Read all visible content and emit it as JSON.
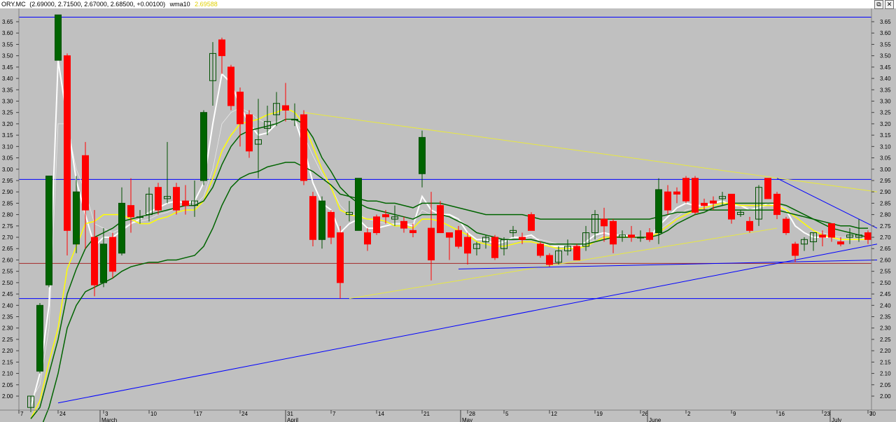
{
  "header": {
    "symbol": "ORY.MC",
    "ohlc_text": "(2.69000, 2.71500, 2.67000, 2.68500, +0.00100)",
    "indicator": "wma10",
    "indicator_value": "2.69588",
    "indicator_color": "#ffff00"
  },
  "window_buttons": {
    "restore": "⧉",
    "close": "✕"
  },
  "colors": {
    "background": "#c0c0c0",
    "up_candle_edge": "#005000",
    "up_candle_fill_strong": "#006400",
    "down_candle": "#ff0000",
    "ma_white": "#ffffff",
    "ma_yellow": "#ffff00",
    "ma_darkgreen": "#006400",
    "ma_thin_white": "#e8e8e8",
    "support_line": "#a52a2a",
    "trend_blue": "#0000ff",
    "trend_yellow": "#e8e840"
  },
  "chart_data": {
    "type": "candlestick",
    "ylim": [
      1.965,
      3.685
    ],
    "y_ticks": [
      2.0,
      2.05,
      2.1,
      2.15,
      2.2,
      2.25,
      2.3,
      2.35,
      2.4,
      2.45,
      2.5,
      2.55,
      2.6,
      2.65,
      2.7,
      2.75,
      2.8,
      2.85,
      2.9,
      2.95,
      3.0,
      3.05,
      3.1,
      3.15,
      3.2,
      3.25,
      3.3,
      3.35,
      3.4,
      3.45,
      3.5,
      3.55,
      3.6,
      3.65
    ],
    "x_day_ticks": [
      "7",
      "24",
      "3",
      "10",
      "17",
      "24",
      "31",
      "7",
      "14",
      "21",
      "28",
      "5",
      "12",
      "19",
      "26",
      "2",
      "9",
      "16",
      "23",
      "30",
      "7"
    ],
    "x_month_labels": [
      "March",
      "April",
      "May",
      "June",
      "July"
    ],
    "candles": [
      {
        "o": 1.95,
        "h": 2.0,
        "l": 1.93,
        "c": 2.0
      },
      {
        "o": 2.11,
        "h": 2.41,
        "l": 2.1,
        "c": 2.4
      },
      {
        "o": 2.49,
        "h": 2.97,
        "l": 2.48,
        "c": 2.97
      },
      {
        "o": 3.48,
        "h": 3.68,
        "l": 3.48,
        "c": 3.68
      },
      {
        "o": 3.5,
        "h": 3.51,
        "l": 2.62,
        "c": 2.73
      },
      {
        "o": 2.67,
        "h": 2.97,
        "l": 2.63,
        "c": 2.9
      },
      {
        "o": 3.06,
        "h": 3.12,
        "l": 2.65,
        "c": 2.82
      },
      {
        "o": 2.7,
        "h": 2.82,
        "l": 2.44,
        "c": 2.49
      },
      {
        "o": 2.5,
        "h": 2.74,
        "l": 2.48,
        "c": 2.67
      },
      {
        "o": 2.7,
        "h": 2.72,
        "l": 2.52,
        "c": 2.55
      },
      {
        "o": 2.63,
        "h": 2.92,
        "l": 2.62,
        "c": 2.85
      },
      {
        "o": 2.84,
        "h": 2.96,
        "l": 2.72,
        "c": 2.79
      },
      {
        "o": 2.79,
        "h": 2.82,
        "l": 2.76,
        "c": 2.79
      },
      {
        "o": 2.8,
        "h": 2.92,
        "l": 2.77,
        "c": 2.89
      },
      {
        "o": 2.92,
        "h": 2.94,
        "l": 2.8,
        "c": 2.82
      },
      {
        "o": 2.87,
        "h": 3.12,
        "l": 2.85,
        "c": 2.88
      },
      {
        "o": 2.92,
        "h": 2.94,
        "l": 2.8,
        "c": 2.82
      },
      {
        "o": 2.86,
        "h": 2.93,
        "l": 2.8,
        "c": 2.84
      },
      {
        "o": 2.84,
        "h": 2.95,
        "l": 2.79,
        "c": 2.86
      },
      {
        "o": 2.95,
        "h": 3.26,
        "l": 2.93,
        "c": 3.25
      },
      {
        "o": 3.39,
        "h": 3.56,
        "l": 3.28,
        "c": 3.51
      },
      {
        "o": 3.57,
        "h": 3.58,
        "l": 3.42,
        "c": 3.5
      },
      {
        "o": 3.45,
        "h": 3.46,
        "l": 3.26,
        "c": 3.28
      },
      {
        "o": 3.34,
        "h": 3.36,
        "l": 3.1,
        "c": 3.2
      },
      {
        "o": 3.24,
        "h": 3.26,
        "l": 3.05,
        "c": 3.08
      },
      {
        "o": 3.11,
        "h": 3.31,
        "l": 2.96,
        "c": 3.13
      },
      {
        "o": 3.18,
        "h": 3.28,
        "l": 3.15,
        "c": 3.21
      },
      {
        "o": 3.24,
        "h": 3.34,
        "l": 3.19,
        "c": 3.29
      },
      {
        "o": 3.28,
        "h": 3.38,
        "l": 3.21,
        "c": 3.26
      },
      {
        "o": 3.22,
        "h": 3.29,
        "l": 3.19,
        "c": 3.22
      },
      {
        "o": 3.24,
        "h": 3.26,
        "l": 2.93,
        "c": 2.95
      },
      {
        "o": 2.88,
        "h": 2.9,
        "l": 2.66,
        "c": 2.69
      },
      {
        "o": 2.69,
        "h": 2.88,
        "l": 2.65,
        "c": 2.86
      },
      {
        "o": 2.81,
        "h": 2.82,
        "l": 2.67,
        "c": 2.7
      },
      {
        "o": 2.72,
        "h": 2.75,
        "l": 2.43,
        "c": 2.5
      },
      {
        "o": 2.8,
        "h": 2.86,
        "l": 2.77,
        "c": 2.81
      },
      {
        "o": 2.73,
        "h": 2.96,
        "l": 2.73,
        "c": 2.96
      },
      {
        "o": 2.72,
        "h": 2.74,
        "l": 2.64,
        "c": 2.67
      },
      {
        "o": 2.79,
        "h": 2.8,
        "l": 2.71,
        "c": 2.72
      },
      {
        "o": 2.8,
        "h": 2.82,
        "l": 2.76,
        "c": 2.79
      },
      {
        "o": 2.78,
        "h": 2.84,
        "l": 2.75,
        "c": 2.79
      },
      {
        "o": 2.77,
        "h": 2.79,
        "l": 2.72,
        "c": 2.74
      },
      {
        "o": 2.73,
        "h": 2.76,
        "l": 2.7,
        "c": 2.72
      },
      {
        "o": 2.98,
        "h": 3.17,
        "l": 2.92,
        "c": 3.14
      },
      {
        "o": 2.74,
        "h": 2.9,
        "l": 2.51,
        "c": 2.6
      },
      {
        "o": 2.84,
        "h": 2.86,
        "l": 2.72,
        "c": 2.72
      },
      {
        "o": 2.72,
        "h": 2.72,
        "l": 2.6,
        "c": 2.7
      },
      {
        "o": 2.73,
        "h": 2.75,
        "l": 2.65,
        "c": 2.66
      },
      {
        "o": 2.7,
        "h": 2.72,
        "l": 2.58,
        "c": 2.63
      },
      {
        "o": 2.65,
        "h": 2.68,
        "l": 2.62,
        "c": 2.67
      },
      {
        "o": 2.68,
        "h": 2.71,
        "l": 2.65,
        "c": 2.7
      },
      {
        "o": 2.7,
        "h": 2.71,
        "l": 2.6,
        "c": 2.61
      },
      {
        "o": 2.65,
        "h": 2.7,
        "l": 2.62,
        "c": 2.69
      },
      {
        "o": 2.72,
        "h": 2.75,
        "l": 2.7,
        "c": 2.73
      },
      {
        "o": 2.7,
        "h": 2.72,
        "l": 2.67,
        "c": 2.69
      },
      {
        "o": 2.8,
        "h": 2.81,
        "l": 2.73,
        "c": 2.73
      },
      {
        "o": 2.67,
        "h": 2.68,
        "l": 2.61,
        "c": 2.62
      },
      {
        "o": 2.62,
        "h": 2.63,
        "l": 2.57,
        "c": 2.58
      },
      {
        "o": 2.59,
        "h": 2.66,
        "l": 2.58,
        "c": 2.64
      },
      {
        "o": 2.64,
        "h": 2.69,
        "l": 2.62,
        "c": 2.66
      },
      {
        "o": 2.66,
        "h": 2.67,
        "l": 2.6,
        "c": 2.6
      },
      {
        "o": 2.66,
        "h": 2.75,
        "l": 2.64,
        "c": 2.72
      },
      {
        "o": 2.72,
        "h": 2.82,
        "l": 2.69,
        "c": 2.8
      },
      {
        "o": 2.78,
        "h": 2.83,
        "l": 2.68,
        "c": 2.75
      },
      {
        "o": 2.77,
        "h": 2.78,
        "l": 2.63,
        "c": 2.67
      },
      {
        "o": 2.7,
        "h": 2.73,
        "l": 2.68,
        "c": 2.71
      },
      {
        "o": 2.71,
        "h": 2.75,
        "l": 2.68,
        "c": 2.7
      },
      {
        "o": 2.7,
        "h": 2.73,
        "l": 2.68,
        "c": 2.7
      },
      {
        "o": 2.72,
        "h": 2.74,
        "l": 2.68,
        "c": 2.69
      },
      {
        "o": 2.72,
        "h": 2.96,
        "l": 2.67,
        "c": 2.91
      },
      {
        "o": 2.9,
        "h": 2.93,
        "l": 2.8,
        "c": 2.82
      },
      {
        "o": 2.9,
        "h": 2.92,
        "l": 2.85,
        "c": 2.89
      },
      {
        "o": 2.96,
        "h": 2.97,
        "l": 2.85,
        "c": 2.86
      },
      {
        "o": 2.96,
        "h": 2.97,
        "l": 2.8,
        "c": 2.81
      },
      {
        "o": 2.85,
        "h": 2.87,
        "l": 2.82,
        "c": 2.84
      },
      {
        "o": 2.86,
        "h": 2.88,
        "l": 2.82,
        "c": 2.85
      },
      {
        "o": 2.87,
        "h": 2.9,
        "l": 2.84,
        "c": 2.88
      },
      {
        "o": 2.89,
        "h": 2.89,
        "l": 2.76,
        "c": 2.78
      },
      {
        "o": 2.8,
        "h": 2.82,
        "l": 2.79,
        "c": 2.81
      },
      {
        "o": 2.77,
        "h": 2.79,
        "l": 2.72,
        "c": 2.73
      },
      {
        "o": 2.78,
        "h": 2.93,
        "l": 2.75,
        "c": 2.92
      },
      {
        "o": 2.96,
        "h": 2.96,
        "l": 2.87,
        "c": 2.87
      },
      {
        "o": 2.89,
        "h": 2.9,
        "l": 2.78,
        "c": 2.8
      },
      {
        "o": 2.78,
        "h": 2.79,
        "l": 2.71,
        "c": 2.72
      },
      {
        "o": 2.67,
        "h": 2.68,
        "l": 2.59,
        "c": 2.62
      },
      {
        "o": 2.67,
        "h": 2.7,
        "l": 2.64,
        "c": 2.69
      },
      {
        "o": 2.68,
        "h": 2.72,
        "l": 2.64,
        "c": 2.72
      },
      {
        "o": 2.71,
        "h": 2.73,
        "l": 2.66,
        "c": 2.7
      },
      {
        "o": 2.76,
        "h": 2.76,
        "l": 2.68,
        "c": 2.7
      },
      {
        "o": 2.68,
        "h": 2.7,
        "l": 2.66,
        "c": 2.67
      },
      {
        "o": 2.7,
        "h": 2.74,
        "l": 2.67,
        "c": 2.71
      },
      {
        "o": 2.7,
        "h": 2.78,
        "l": 2.68,
        "c": 2.71
      },
      {
        "o": 2.72,
        "h": 2.73,
        "l": 2.67,
        "c": 2.69
      }
    ],
    "moving_averages": [
      {
        "style": "white",
        "values": [
          1.95,
          2.1,
          2.4,
          3.48,
          3.22,
          2.95,
          2.8,
          2.66,
          2.7,
          2.7,
          2.73,
          2.76,
          2.78,
          2.81,
          2.83,
          2.85,
          2.86,
          2.85,
          2.86,
          2.94,
          3.2,
          3.42,
          3.38,
          3.28,
          3.2,
          3.15,
          3.16,
          3.2,
          3.22,
          3.22,
          3.1,
          2.94,
          2.85,
          2.82,
          2.72,
          2.76,
          2.78,
          2.74,
          2.74,
          2.75,
          2.76,
          2.76,
          2.75,
          2.88,
          2.82,
          2.8,
          2.8,
          2.78,
          2.72,
          2.69,
          2.69,
          2.67,
          2.68,
          2.7,
          2.7,
          2.71,
          2.68,
          2.66,
          2.66,
          2.66,
          2.65,
          2.68,
          2.71,
          2.72,
          2.71,
          2.71,
          2.7,
          2.7,
          2.7,
          2.75,
          2.79,
          2.83,
          2.85,
          2.84,
          2.84,
          2.85,
          2.86,
          2.84,
          2.84,
          2.82,
          2.83,
          2.85,
          2.84,
          2.82,
          2.75,
          2.72,
          2.7,
          2.7,
          2.7,
          2.69,
          2.69,
          2.69,
          2.69
        ]
      },
      {
        "style": "thin",
        "values": [
          1.98,
          2.05,
          2.3,
          3.2,
          3.2,
          3.0,
          2.9,
          2.76,
          2.74,
          2.72,
          2.74,
          2.76,
          2.77,
          2.78,
          2.8,
          2.81,
          2.83,
          2.84,
          2.84,
          2.88,
          3.0,
          3.2,
          3.25,
          3.27,
          3.25,
          3.22,
          3.2,
          3.21,
          3.22,
          3.22,
          3.15,
          3.06,
          2.98,
          2.92,
          2.84,
          2.8,
          2.8,
          2.78,
          2.77,
          2.76,
          2.76,
          2.76,
          2.76,
          2.82,
          2.8,
          2.8,
          2.79,
          2.78,
          2.75,
          2.72,
          2.71,
          2.69,
          2.68,
          2.68,
          2.69,
          2.7,
          2.69,
          2.68,
          2.67,
          2.67,
          2.66,
          2.67,
          2.69,
          2.71,
          2.71,
          2.71,
          2.71,
          2.7,
          2.7,
          2.73,
          2.76,
          2.79,
          2.82,
          2.83,
          2.84,
          2.84,
          2.85,
          2.84,
          2.84,
          2.83,
          2.83,
          2.84,
          2.84,
          2.83,
          2.79,
          2.76,
          2.73,
          2.72,
          2.71,
          2.7,
          2.7,
          2.7,
          2.69
        ]
      },
      {
        "style": "yellow",
        "values": [
          1.9,
          1.98,
          2.15,
          2.3,
          2.56,
          2.66,
          2.76,
          2.77,
          2.8,
          2.8,
          2.8,
          2.78,
          2.76,
          2.76,
          2.78,
          2.79,
          2.81,
          2.82,
          2.82,
          2.86,
          2.96,
          3.08,
          3.15,
          3.2,
          3.21,
          3.22,
          3.24,
          3.25,
          3.27,
          3.25,
          3.2,
          3.1,
          3.0,
          2.92,
          2.82,
          2.8,
          2.79,
          2.78,
          2.78,
          2.77,
          2.75,
          2.75,
          2.74,
          2.78,
          2.78,
          2.77,
          2.75,
          2.73,
          2.71,
          2.68,
          2.67,
          2.66,
          2.66,
          2.67,
          2.68,
          2.68,
          2.67,
          2.66,
          2.65,
          2.65,
          2.65,
          2.66,
          2.68,
          2.7,
          2.7,
          2.7,
          2.7,
          2.7,
          2.7,
          2.72,
          2.75,
          2.78,
          2.8,
          2.82,
          2.83,
          2.84,
          2.85,
          2.85,
          2.84,
          2.84,
          2.84,
          2.84,
          2.84,
          2.82,
          2.79,
          2.76,
          2.73,
          2.71,
          2.7,
          2.69,
          2.69,
          2.69,
          2.69
        ]
      },
      {
        "style": "darkgreen",
        "values": [
          1.9,
          1.95,
          2.1,
          2.25,
          2.45,
          2.56,
          2.65,
          2.7,
          2.72,
          2.74,
          2.77,
          2.78,
          2.79,
          2.8,
          2.81,
          2.82,
          2.83,
          2.84,
          2.84,
          2.86,
          2.92,
          3.02,
          3.1,
          3.15,
          3.17,
          3.18,
          3.19,
          3.2,
          3.22,
          3.22,
          3.2,
          3.14,
          3.05,
          2.99,
          2.92,
          2.88,
          2.85,
          2.83,
          2.82,
          2.81,
          2.8,
          2.79,
          2.78,
          2.8,
          2.8,
          2.8,
          2.79,
          2.77,
          2.75,
          2.72,
          2.71,
          2.7,
          2.69,
          2.69,
          2.69,
          2.69,
          2.68,
          2.67,
          2.67,
          2.67,
          2.67,
          2.67,
          2.68,
          2.69,
          2.7,
          2.7,
          2.7,
          2.7,
          2.7,
          2.71,
          2.73,
          2.76,
          2.78,
          2.8,
          2.81,
          2.83,
          2.84,
          2.85,
          2.85,
          2.85,
          2.85,
          2.85,
          2.85,
          2.84,
          2.82,
          2.8,
          2.78,
          2.76,
          2.74,
          2.73,
          2.72,
          2.71,
          2.7
        ]
      },
      {
        "style": "darkgreen",
        "values": [
          1.8,
          1.85,
          1.95,
          2.1,
          2.3,
          2.4,
          2.46,
          2.48,
          2.5,
          2.52,
          2.55,
          2.57,
          2.58,
          2.59,
          2.59,
          2.6,
          2.6,
          2.61,
          2.62,
          2.66,
          2.74,
          2.84,
          2.92,
          2.96,
          2.98,
          2.99,
          3.01,
          3.02,
          3.03,
          3.03,
          3.01,
          2.99,
          2.96,
          2.93,
          2.89,
          2.88,
          2.87,
          2.86,
          2.86,
          2.85,
          2.85,
          2.84,
          2.83,
          2.85,
          2.85,
          2.85,
          2.84,
          2.83,
          2.82,
          2.81,
          2.8,
          2.8,
          2.8,
          2.8,
          2.8,
          2.79,
          2.78,
          2.78,
          2.78,
          2.78,
          2.78,
          2.78,
          2.78,
          2.78,
          2.78,
          2.78,
          2.78,
          2.78,
          2.78,
          2.79,
          2.8,
          2.81,
          2.81,
          2.82,
          2.82,
          2.82,
          2.82,
          2.82,
          2.82,
          2.82,
          2.82,
          2.82,
          2.82,
          2.81,
          2.8,
          2.79,
          2.78,
          2.77,
          2.76,
          2.75,
          2.75,
          2.74,
          2.74
        ]
      }
    ],
    "horizontal_lines": [
      {
        "y": 3.67,
        "color": "blue"
      },
      {
        "y": 2.955,
        "color": "blue"
      },
      {
        "y": 2.585,
        "color": "brown"
      },
      {
        "y": 2.43,
        "color": "blue"
      }
    ],
    "trend_lines": [
      {
        "from": [
          3,
          1.97
        ],
        "to": [
          93,
          2.67
        ],
        "color": "blue"
      },
      {
        "from": [
          30,
          3.25
        ],
        "to": [
          93,
          2.9
        ],
        "color": "yellow"
      },
      {
        "from": [
          35,
          2.43
        ],
        "to": [
          82,
          2.74
        ],
        "color": "yellow"
      },
      {
        "from": [
          82,
          2.96
        ],
        "to": [
          93,
          2.74
        ],
        "color": "blue"
      },
      {
        "from": [
          47,
          2.56
        ],
        "to": [
          93,
          2.6
        ],
        "color": "blue"
      }
    ]
  }
}
